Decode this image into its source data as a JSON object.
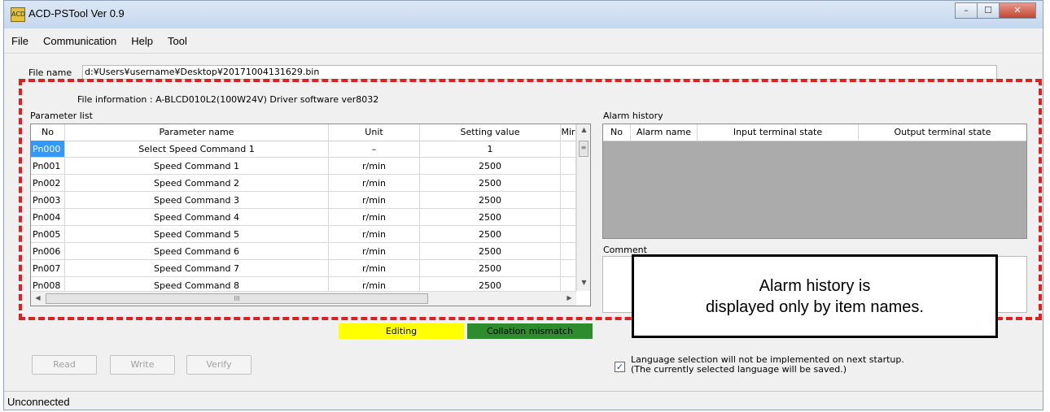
{
  "window": {
    "title": "ACD-PSTool Ver 0.9",
    "icon_text": "ACD"
  },
  "menu": [
    "File",
    "Communication",
    "Help",
    "Tool"
  ],
  "file": {
    "label": "File name",
    "path": "d:¥Users¥username¥Desktop¥20171004131629.bin",
    "info": "File information : A-BLCD010L2(100W24V)  Driver software ver8032"
  },
  "parameter_list": {
    "label": "Parameter list",
    "columns": [
      "No",
      "Parameter name",
      "Unit",
      "Setting value",
      "Mir"
    ],
    "rows": [
      [
        "Pn000",
        "Select Speed Command 1",
        "–",
        "1",
        ""
      ],
      [
        "Pn001",
        "Speed Command 1",
        "r/min",
        "2500",
        ""
      ],
      [
        "Pn002",
        "Speed Command 2",
        "r/min",
        "2500",
        ""
      ],
      [
        "Pn003",
        "Speed Command 3",
        "r/min",
        "2500",
        ""
      ],
      [
        "Pn004",
        "Speed Command 4",
        "r/min",
        "2500",
        ""
      ],
      [
        "Pn005",
        "Speed Command 5",
        "r/min",
        "2500",
        ""
      ],
      [
        "Pn006",
        "Speed Command 6",
        "r/min",
        "2500",
        ""
      ],
      [
        "Pn007",
        "Speed Command 7",
        "r/min",
        "2500",
        ""
      ],
      [
        "Pn008",
        "Speed Command 8",
        "r/min",
        "2500",
        ""
      ]
    ],
    "scroll_thumb_glyph": "III"
  },
  "alarm_history": {
    "label": "Alarm history",
    "columns": [
      "No",
      "Alarm name",
      "Input terminal state",
      "Output terminal state"
    ]
  },
  "comment": {
    "label": "Comment"
  },
  "callout": {
    "line1": "Alarm history is",
    "line2": "displayed only by item names."
  },
  "status_tags": {
    "editing": "Editing",
    "mismatch": "Collation mismatch"
  },
  "buttons": {
    "read": "Read",
    "write": "Write",
    "verify": "Verify"
  },
  "language_checkbox": {
    "checked": true,
    "line1": "Language selection will not be implemented on next startup.",
    "line2": "(The currently selected language will be saved.)"
  },
  "statusbar": {
    "text": "Unconnected"
  },
  "colors": {
    "dashed_border": "#e02020",
    "editing_bg": "#ffff00",
    "mismatch_bg": "#2e8b2e",
    "selection": "#3399ff"
  }
}
